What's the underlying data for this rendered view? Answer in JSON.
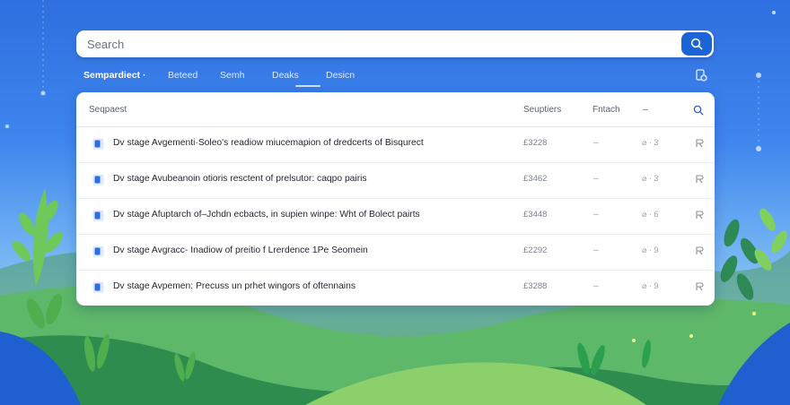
{
  "search": {
    "placeholder": "Search"
  },
  "tabs": [
    {
      "label": "Sempardiect ·",
      "active": true
    },
    {
      "label": "Beteed",
      "active": false
    },
    {
      "label": "Semh",
      "active": false
    },
    {
      "label": "Deaks",
      "active": false
    },
    {
      "label": "Desicn",
      "active": false
    }
  ],
  "table": {
    "headers": {
      "name": "Seqpaest",
      "size": "Seuptiers",
      "fetch": "Fntach",
      "extra": "–"
    },
    "rows": [
      {
        "title": "Dv stage Avgementi·Soleo's readiow miucemapion of dredcerts of Bisqurect",
        "size": "£3228",
        "dash": "–",
        "count": "⌀ · 3"
      },
      {
        "title": "Dv stage Avubeanoin otioris resctent of prelsutor: caqpo pairis",
        "size": "£3462",
        "dash": "–",
        "count": "⌀ · 3"
      },
      {
        "title": "Dv stage Afuptarch of–Jchdn ecbacts, in supien winpe: Wht of Bolect pairts",
        "size": "£3448",
        "dash": "–",
        "count": "⌀ · 6"
      },
      {
        "title": "Dv stage Avgracc- Inadiow of preitio  f Lrerdence 1Pe Seomein",
        "size": "£2292",
        "dash": "–",
        "count": "⌀ · 9"
      },
      {
        "title": "Dv stage Avpemen: Precuss un prhet wingors of oftennains",
        "size": "£3288",
        "dash": "–",
        "count": "⌀ · 9"
      }
    ]
  },
  "colors": {
    "accent": "#1a64d6",
    "doc_icon": "#2b6fe0"
  }
}
